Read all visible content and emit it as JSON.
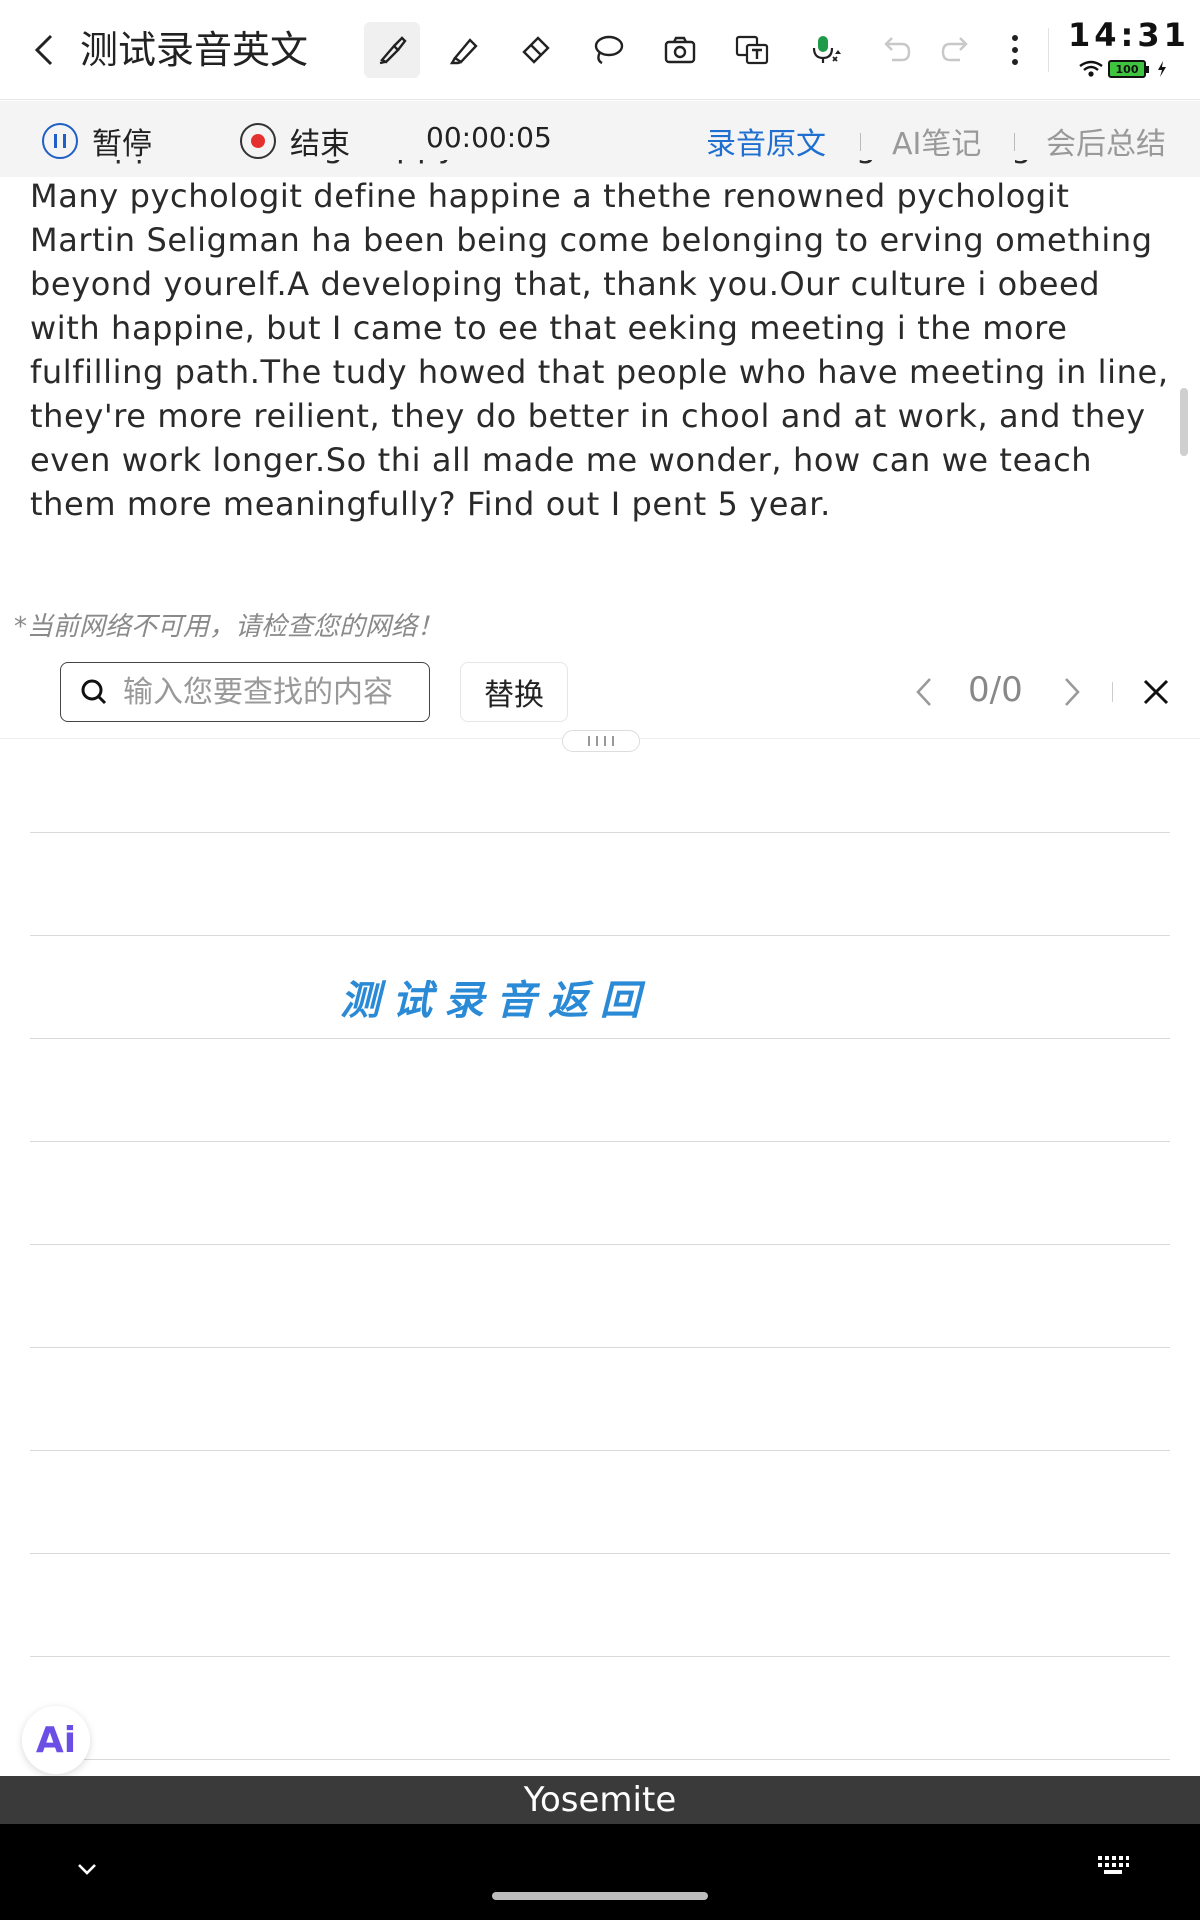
{
  "header": {
    "title": "测试录音英文",
    "clock": "14:31",
    "battery": "100"
  },
  "toolbar": {
    "tools": [
      "brush-icon",
      "highlighter-icon",
      "eraser-icon",
      "lasso-icon",
      "camera-icon",
      "translate-icon",
      "mic-icon",
      "undo-icon",
      "redo-icon",
      "more-icon"
    ]
  },
  "recording": {
    "pause_label": "暂停",
    "stop_label": "结束",
    "elapsed": "00:00:05",
    "tabs": [
      {
        "label": "录音原文",
        "active": true
      },
      {
        "label": "AI笔记",
        "active": false
      },
      {
        "label": "会后总结",
        "active": false
      }
    ]
  },
  "transcript": {
    "cut_line": "of happiness being happy is not the same as being meaningful.",
    "text": "Many pychologit define happine a thethe renowned pychologit Martin Seligman ha been being come belonging to erving omething beyond yourelf.A developing that, thank you.Our culture i obeed with happine, but I came to ee that eeking meeting i the more fulfilling path.The tudy howed that people who have meeting in line, they're more reilient, they do better in chool and at work, and they even work longer.So thi all made me wonder, how can we teach them more meaningfully? Find out I pent 5 year."
  },
  "network_warning": "*当前网络不可用，请检查您的网络！",
  "search": {
    "placeholder": "输入您要查找的内容",
    "value": "",
    "replace_label": "替换",
    "counter": "0/0"
  },
  "note": {
    "handwriting": "测试录音返回"
  },
  "ai_badge": "Ai",
  "keyboard_hint": "Yosemite",
  "colors": {
    "accent": "#1f6fd0",
    "stop": "#e53030",
    "handwriting": "#2b8ad6"
  }
}
